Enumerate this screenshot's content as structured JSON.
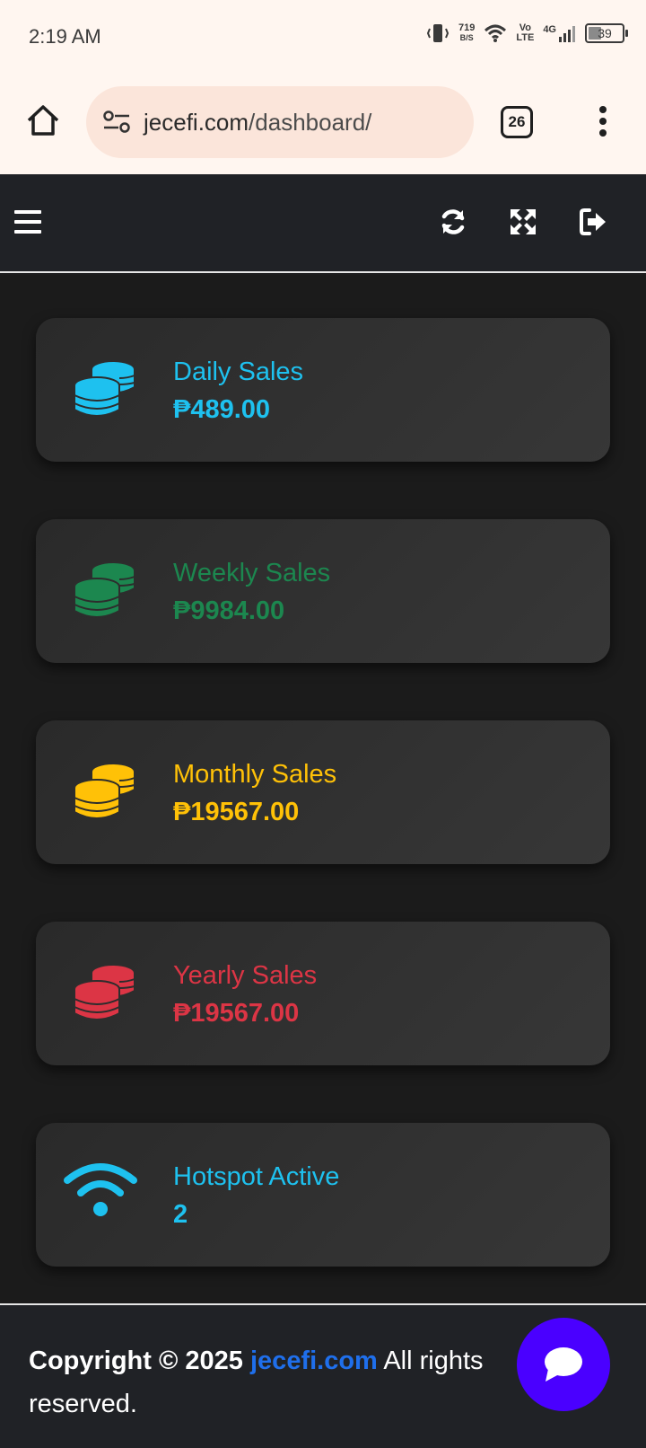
{
  "status_bar": {
    "time": "2:19 AM",
    "net_speed_value": "719",
    "net_speed_unit": "B/S",
    "volte_top": "Vo",
    "volte_bottom": "LTE",
    "network": "4G",
    "battery": "39"
  },
  "browser": {
    "url_domain": "jecefi.com",
    "url_path": "/dashboard/",
    "tab_count": "26"
  },
  "cards": [
    {
      "label": "Daily Sales",
      "value": "₱489.00",
      "color": "#1ec1ef",
      "icon": "coins-icon"
    },
    {
      "label": "Weekly Sales",
      "value": "₱9984.00",
      "color": "#1c874f",
      "icon": "coins-icon"
    },
    {
      "label": "Monthly Sales",
      "value": "₱19567.00",
      "color": "#ffc107",
      "icon": "coins-icon"
    },
    {
      "label": "Yearly Sales",
      "value": "₱19567.00",
      "color": "#dc3545",
      "icon": "coins-icon"
    },
    {
      "label": "Hotspot Active",
      "value": "2",
      "color": "#1ec1ef",
      "icon": "wifi-icon"
    }
  ],
  "footer": {
    "copyright": "Copyright © 2025",
    "site": "jecefi.com",
    "rights": "All rights reserved."
  }
}
